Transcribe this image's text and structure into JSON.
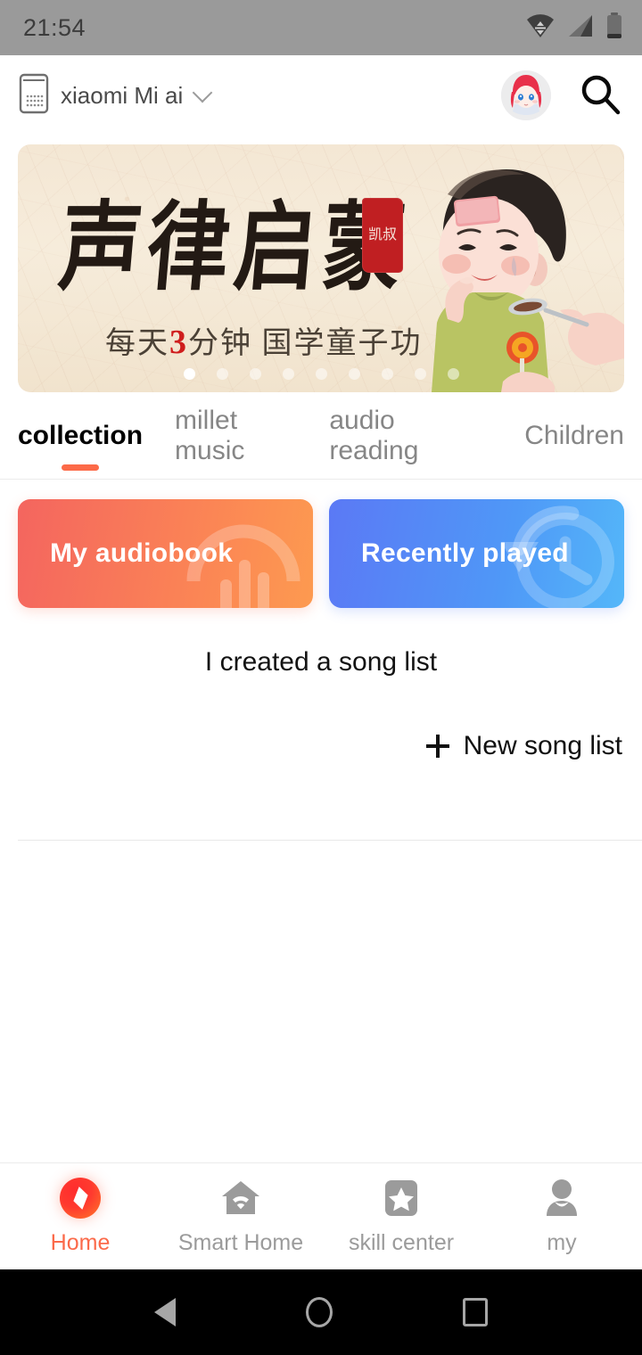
{
  "status_bar": {
    "time": "21:54",
    "icons": [
      "wifi-data-icon",
      "cellular-signal-icon",
      "battery-icon"
    ],
    "background": "#9a9a9a"
  },
  "header": {
    "device_icon": "smart-speaker-icon",
    "device_name": "xiaomi Mi ai",
    "dropdown_icon": "chevron-down-icon",
    "avatar": "user-avatar",
    "search_icon": "search-icon"
  },
  "banner": {
    "title": "声律启蒙",
    "seal_text": "凯叔",
    "subtitle_prefix": "每天",
    "subtitle_number": "3",
    "subtitle_suffix": "分钟  国学童子功",
    "illustration": "child-taking-medicine-illustration",
    "dot_count": 9,
    "active_dot": 1,
    "paper_color": "#f4e7d4",
    "ink_color": "#231a14",
    "accent_red": "#cf1d1d"
  },
  "tabs": [
    {
      "label": "collection",
      "active": true
    },
    {
      "label": "millet music",
      "active": false
    },
    {
      "label": "audio reading",
      "active": false
    },
    {
      "label": "Children",
      "active": false
    }
  ],
  "tab_indicator_color": "#fc6a48",
  "shortcut_cards": [
    {
      "label": "My audiobook",
      "watermark_icon": "audiobook-waveform-icon",
      "gradient_from": "#f4655f",
      "gradient_to": "#fd9a50"
    },
    {
      "label": "Recently played",
      "watermark_icon": "history-clock-icon",
      "gradient_from": "#5b79f5",
      "gradient_to": "#54b7f9"
    }
  ],
  "song_list_section": {
    "title": "I created a song list",
    "new_button_label": "New song list",
    "new_button_icon": "plus-icon"
  },
  "bottom_nav": [
    {
      "label": "Home",
      "icon": "compass-home-icon",
      "active": true
    },
    {
      "label": "Smart Home",
      "icon": "house-wifi-icon",
      "active": false
    },
    {
      "label": "skill center",
      "icon": "star-badge-icon",
      "active": false
    },
    {
      "label": "my",
      "icon": "person-icon",
      "active": false
    }
  ],
  "bottom_nav_active_color": "#fb6a4a",
  "bottom_nav_inactive_color": "#9b9b9b",
  "system_nav": [
    {
      "icon": "back-triangle-icon"
    },
    {
      "icon": "home-circle-icon"
    },
    {
      "icon": "recents-square-icon"
    }
  ]
}
